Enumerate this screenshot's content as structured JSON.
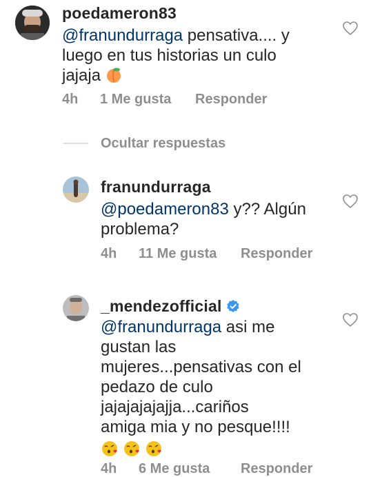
{
  "comments": [
    {
      "username": "poedameron83",
      "mention": "@franundurraga",
      "lines": [
        " pensativa.... y",
        "luego en tus historias un culo",
        "jajaja "
      ],
      "emoji": "peach",
      "time": "4h",
      "likes": "1 Me gusta",
      "reply": "Responder"
    },
    {
      "username": "franundurraga",
      "mention": "@poedameron83",
      "lines": [
        " y?? Algún",
        "problema?"
      ],
      "time": "4h",
      "likes": "11 Me gusta",
      "reply": "Responder"
    },
    {
      "username": "_mendezofficial",
      "verified": true,
      "mention": "@franundurraga",
      "lines": [
        " asi me",
        "gustan las",
        "mujeres...pensativas con el",
        "pedazo de culo",
        "jajajajajajja...cariños",
        "amiga  mia y no pesque!!!!"
      ],
      "emoji": "kissing-face-heart x3",
      "time": "4h",
      "likes": "6 Me gusta",
      "reply": "Responder"
    }
  ],
  "hide_replies_label": "Ocultar respuestas",
  "colors": {
    "text": "#262626",
    "mention": "#003569",
    "meta": "#8e8e8e",
    "verified": "#3897f0"
  }
}
